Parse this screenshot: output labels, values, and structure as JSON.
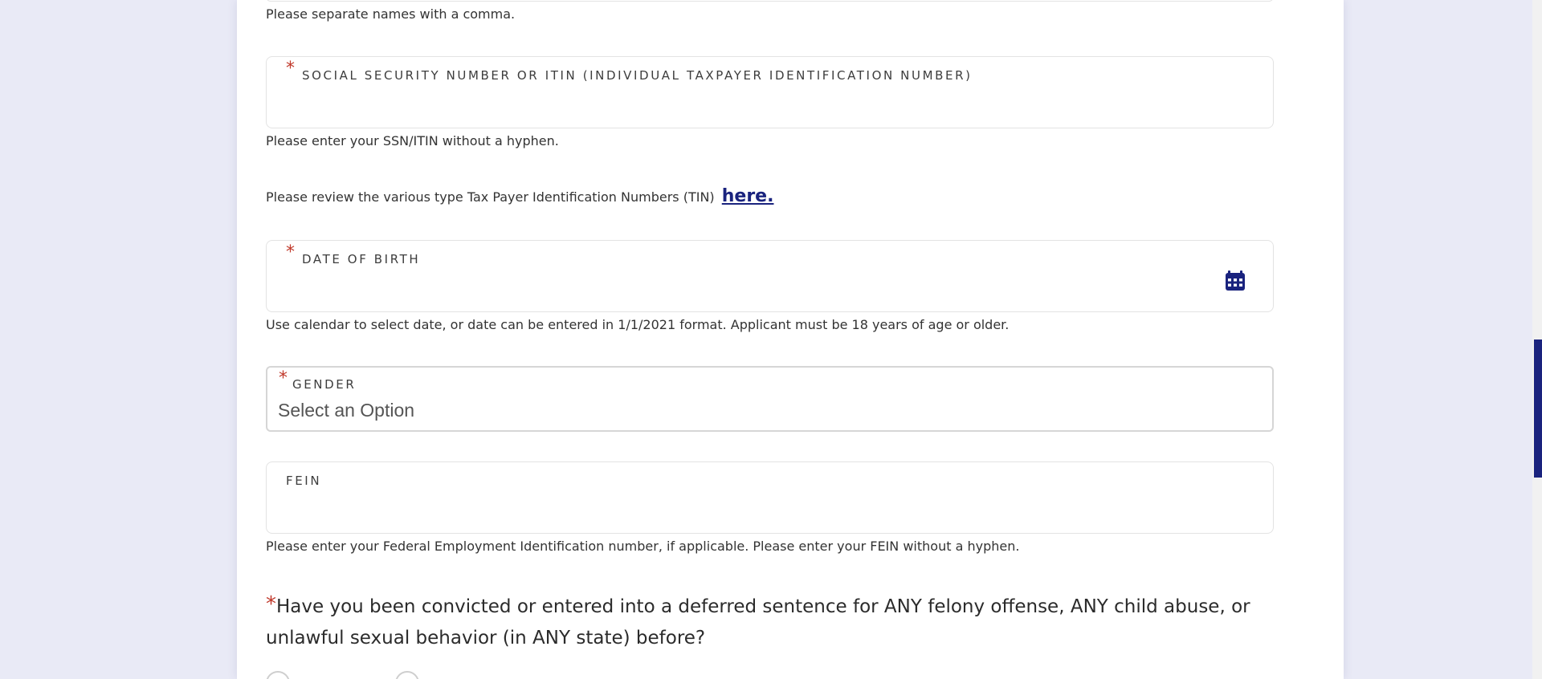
{
  "colors": {
    "accent": "#1a237e",
    "required": "#c0392b",
    "page_bg": "#e9eaf6"
  },
  "prev_help": "Please separate names with a comma.",
  "ssn": {
    "required_mark": "*",
    "label": "SOCIAL SECURITY NUMBER OR ITIN (INDIVIDUAL TAXPAYER IDENTIFICATION NUMBER)",
    "value": "",
    "help": "Please enter your SSN/ITIN without a hyphen."
  },
  "tin_review": {
    "text": "Please review the various type Tax Payer Identification Numbers (TIN)",
    "link": "here."
  },
  "dob": {
    "required_mark": "*",
    "label": "DATE OF BIRTH",
    "value": "",
    "icon": "calendar-icon",
    "help": "Use calendar to select date, or date can be entered in 1/1/2021 format. Applicant must be 18 years of age or older."
  },
  "gender": {
    "required_mark": "*",
    "label": "GENDER",
    "placeholder": "Select an Option"
  },
  "fein": {
    "label": "FEIN",
    "value": "",
    "help": "Please enter your Federal Employment Identification number, if applicable. Please enter your FEIN without a hyphen."
  },
  "felony_question": {
    "required_mark": "*",
    "text": "Have you been convicted or entered into a deferred sentence for ANY felony offense, ANY child abuse, or unlawful sexual behavior (in ANY state) before?"
  }
}
